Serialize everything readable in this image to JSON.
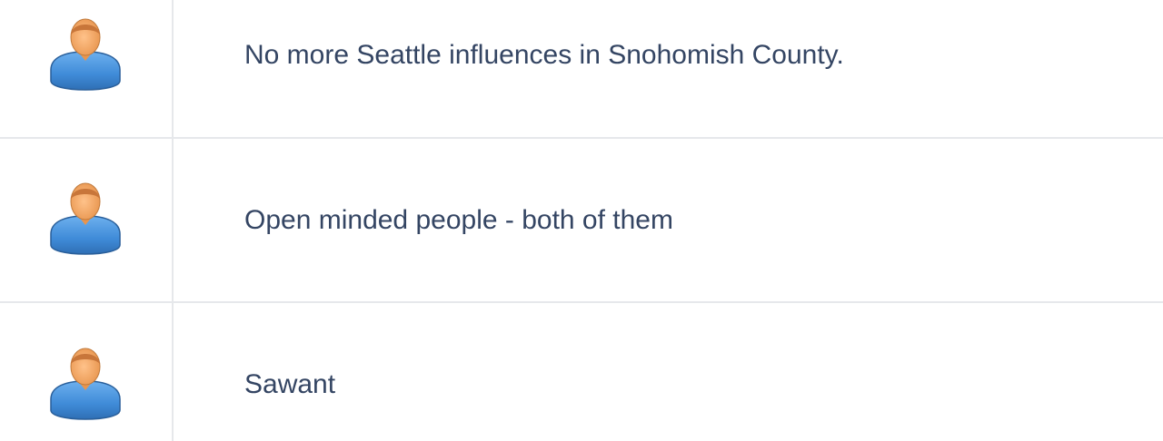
{
  "comments": [
    {
      "avatar_icon": "user-avatar-icon",
      "text": "No more Seattle influences in Snohomish County."
    },
    {
      "avatar_icon": "user-avatar-icon",
      "text": "Open minded people - both of them"
    },
    {
      "avatar_icon": "user-avatar-icon",
      "text": "Sawant"
    }
  ],
  "colors": {
    "text": "#344563",
    "divider": "#e6e8eb",
    "avatar_body": "#4a8fd9",
    "avatar_head": "#f0a057",
    "avatar_hair": "#c8763a"
  }
}
